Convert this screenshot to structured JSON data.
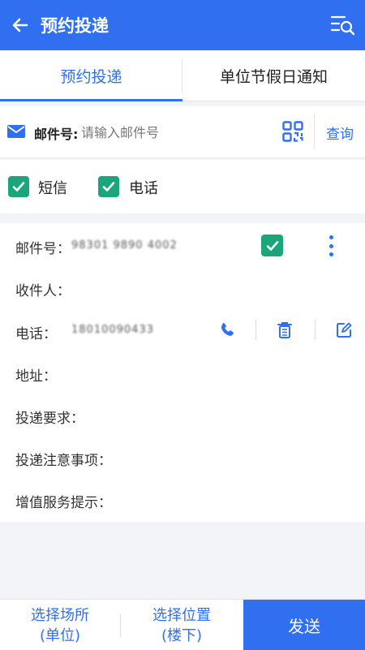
{
  "header": {
    "title": "预约投递"
  },
  "tabs": [
    {
      "label": "预约投递",
      "active": true
    },
    {
      "label": "单位节假日通知",
      "active": false
    }
  ],
  "search": {
    "label": "邮件号:",
    "placeholder": "请输入邮件号",
    "query_label": "查询"
  },
  "notify": {
    "sms_label": "短信",
    "sms_checked": true,
    "phone_label": "电话",
    "phone_checked": true
  },
  "item": {
    "mail_no_label": "邮件号：",
    "mail_no_value": "98301 9890 4002",
    "checked": true,
    "recipient_label": "收件人：",
    "phone_label": "电话：",
    "phone_value": "18010090433",
    "address_label": "地址：",
    "delivery_req_label": "投递要求：",
    "delivery_notes_label": "投递注意事项：",
    "value_added_label": "增值服务提示："
  },
  "bottom": {
    "place_line1": "选择场所",
    "place_line2": "(单位)",
    "position_line1": "选择位置",
    "position_line2": "(楼下)",
    "send_label": "发送"
  },
  "colors": {
    "primary": "#2f6ff0",
    "check_green": "#1aa67a"
  }
}
